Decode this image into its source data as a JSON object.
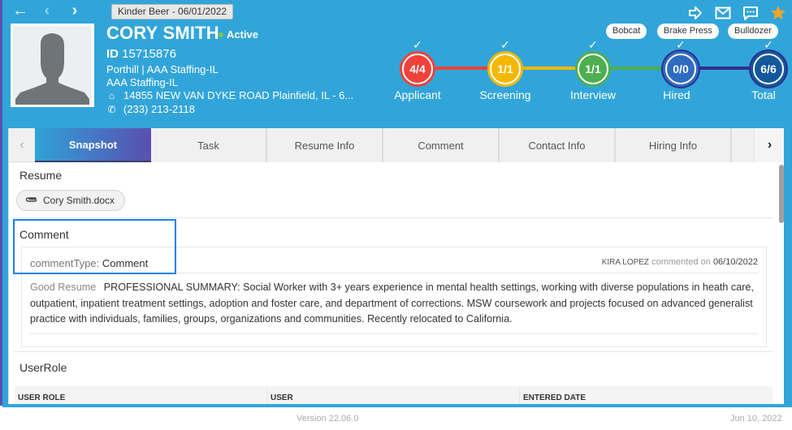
{
  "header": {
    "context_chip": "Kinder Beer - 06/01/2022",
    "name": "CORY SMITH",
    "status": "Active",
    "id_label": "ID",
    "id_value": "15715876",
    "branch_line": "Porthill | AAA Staffing-IL",
    "company": "AAA Staffing-IL",
    "address": "14855 NEW VAN DYKE ROAD Plainfield, IL - 6...",
    "phone": "(233) 213-2118",
    "skills": [
      "Bobcat",
      "Brake Press",
      "Bulldozer"
    ],
    "colors": {
      "background": "#31a5d9",
      "active_dot": "#8bc34a",
      "star": "#f5a623"
    }
  },
  "pipeline": {
    "stages": [
      {
        "label": "Applicant",
        "value": "4/4",
        "color": "#f0413a",
        "checked": true
      },
      {
        "label": "Screening",
        "value": "1/1",
        "color": "#f5b800",
        "checked": true
      },
      {
        "label": "Interview",
        "value": "1/1",
        "color": "#4caf50",
        "checked": true
      },
      {
        "label": "Hired",
        "value": "0/0",
        "color": "#2f6cc1",
        "checked": true
      },
      {
        "label": "Total",
        "value": "6/6",
        "color": "#13589c",
        "checked": true
      }
    ],
    "connector_colors": [
      "#f0413a",
      "#f5b800",
      "#4caf50",
      "#2e2f8f"
    ]
  },
  "tabs": {
    "items": [
      "Snapshot",
      "Task",
      "Resume Info",
      "Comment",
      "Contact Info",
      "Hiring Info"
    ],
    "active": "Snapshot"
  },
  "resume": {
    "title": "Resume",
    "file": "Cory Smith.docx"
  },
  "comment": {
    "title": "Comment",
    "type_label": "commentType:",
    "type_value": "Comment",
    "author": "KIRA LOPEZ",
    "commented_on": "commented on",
    "date": "06/10/2022",
    "lead": "Good Resume",
    "body": "PROFESSIONAL SUMMARY: Social Worker with 3+ years experience in mental health settings, working with diverse populations in heath care, outpatient, inpatient treatment settings, adoption and foster care, and department of corrections. MSW coursework and projects focused on advanced generalist practice with individuals, families, groups, organizations and communities. Recently relocated to California."
  },
  "userrole": {
    "title": "UserRole",
    "columns": [
      "USER ROLE",
      "USER",
      "ENTERED DATE"
    ]
  },
  "footer": {
    "version": "Version 22.06.0",
    "date": "Jun 10, 2022"
  }
}
